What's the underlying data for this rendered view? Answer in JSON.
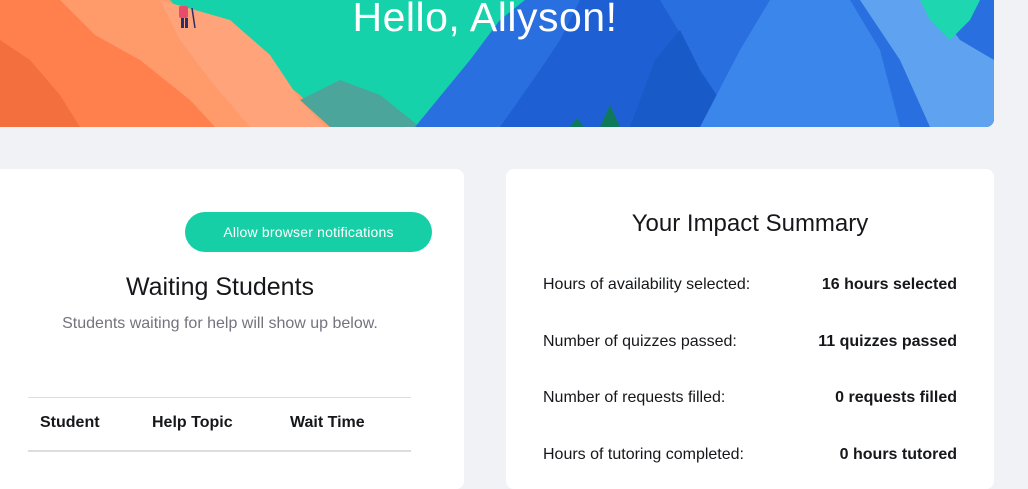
{
  "hero": {
    "greeting": "Hello, Allyson!"
  },
  "waiting": {
    "notify_button": "Allow browser notifications",
    "title": "Waiting Students",
    "subtitle": "Students waiting for help will show up below.",
    "columns": [
      "Student",
      "Help Topic",
      "Wait Time"
    ]
  },
  "impact": {
    "title": "Your Impact Summary",
    "rows": [
      {
        "label": "Hours of availability selected:",
        "value": "16 hours selected"
      },
      {
        "label": "Number of quizzes passed:",
        "value": "11 quizzes passed"
      },
      {
        "label": "Number of requests filled:",
        "value": "0 requests filled"
      },
      {
        "label": "Hours of tutoring completed:",
        "value": "0 hours tutored"
      }
    ]
  },
  "colors": {
    "accent": "#16cfa6",
    "page_background": "#f0f2f5",
    "hero_orange": "#ff8a5c",
    "hero_blue": "#2a6fe0"
  }
}
